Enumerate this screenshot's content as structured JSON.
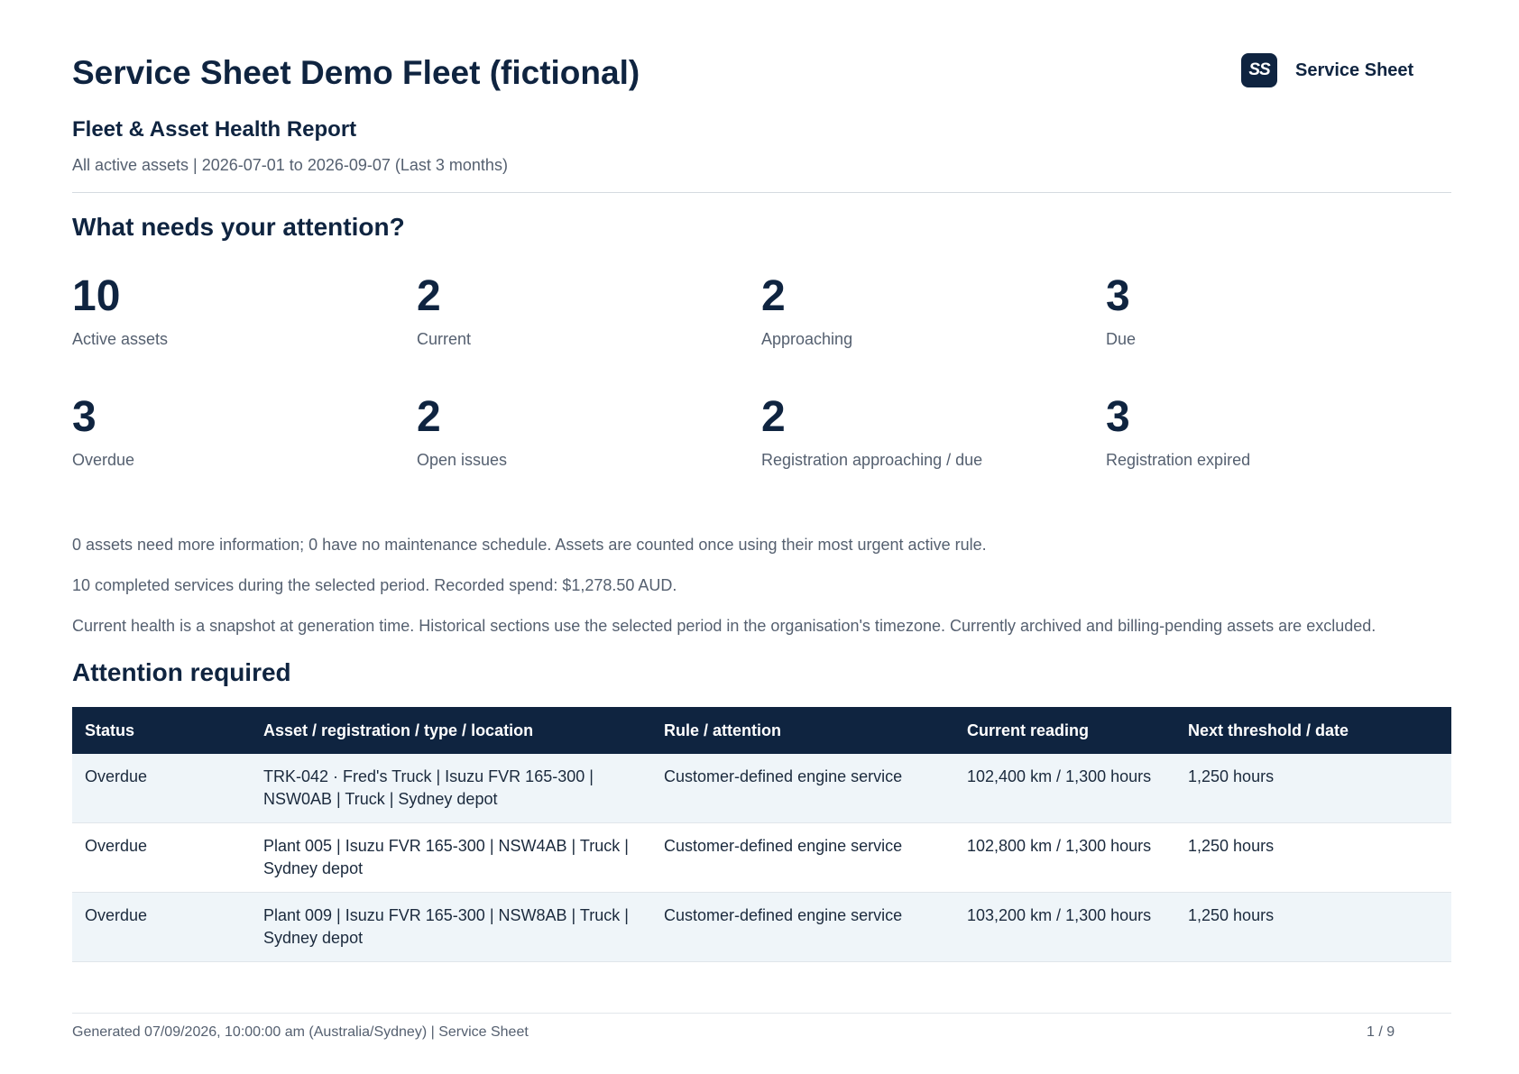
{
  "header": {
    "title": "Service Sheet Demo Fleet (fictional)",
    "subtitle": "Fleet & Asset Health Report",
    "scope": "All active assets | 2026-07-01 to 2026-09-07 (Last 3 months)",
    "brand_logo_text": "SS",
    "brand_name": "Service Sheet"
  },
  "attention": {
    "heading": "What needs your attention?",
    "metrics": [
      {
        "value": "10",
        "label": "Active assets"
      },
      {
        "value": "2",
        "label": "Current"
      },
      {
        "value": "2",
        "label": "Approaching"
      },
      {
        "value": "3",
        "label": "Due"
      },
      {
        "value": "3",
        "label": "Overdue"
      },
      {
        "value": "2",
        "label": "Open issues"
      },
      {
        "value": "2",
        "label": "Registration approaching / due"
      },
      {
        "value": "3",
        "label": "Registration expired"
      }
    ]
  },
  "notes": [
    "0 assets need more information; 0 have no maintenance schedule. Assets are counted once using their most urgent active rule.",
    "10 completed services during the selected period. Recorded spend: $1,278.50 AUD.",
    "Current health is a snapshot at generation time. Historical sections use the selected period in the organisation's timezone. Currently archived and billing-pending assets are excluded."
  ],
  "table": {
    "heading": "Attention required",
    "columns": [
      "Status",
      "Asset / registration / type / location",
      "Rule / attention",
      "Current reading",
      "Next threshold / date"
    ],
    "rows": [
      [
        "Overdue",
        "TRK-042 · Fred's Truck | Isuzu FVR 165-300 | NSW0AB | Truck | Sydney depot",
        "Customer-defined engine service",
        "102,400 km / 1,300 hours",
        "1,250 hours"
      ],
      [
        "Overdue",
        "Plant 005 | Isuzu FVR 165-300 | NSW4AB | Truck | Sydney depot",
        "Customer-defined engine service",
        "102,800 km / 1,300 hours",
        "1,250 hours"
      ],
      [
        "Overdue",
        "Plant 009 | Isuzu FVR 165-300 | NSW8AB | Truck | Sydney depot",
        "Customer-defined engine service",
        "103,200 km / 1,300 hours",
        "1,250 hours"
      ]
    ]
  },
  "footer": {
    "generated": "Generated 07/09/2026, 10:00:00 am (Australia/Sydney) | Service Sheet",
    "page": "1 / 9"
  }
}
